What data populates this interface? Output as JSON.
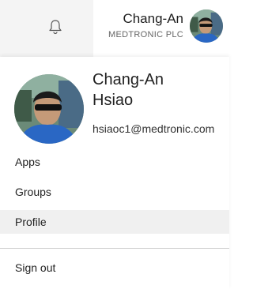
{
  "header": {
    "user_name": "Chang-An",
    "company": "MEDTRONIC PLC"
  },
  "account_menu": {
    "name_line1": "Chang-An",
    "name_line2": "Hsiao",
    "email": "hsiaoc1@medtronic.com",
    "items": [
      {
        "label": "Apps"
      },
      {
        "label": "Groups"
      },
      {
        "label": "Profile",
        "active": true
      }
    ],
    "sign_out_label": "Sign out"
  },
  "colors": {
    "active_item_bg": "#f0f0f0",
    "divider": "#cfcfcf"
  }
}
